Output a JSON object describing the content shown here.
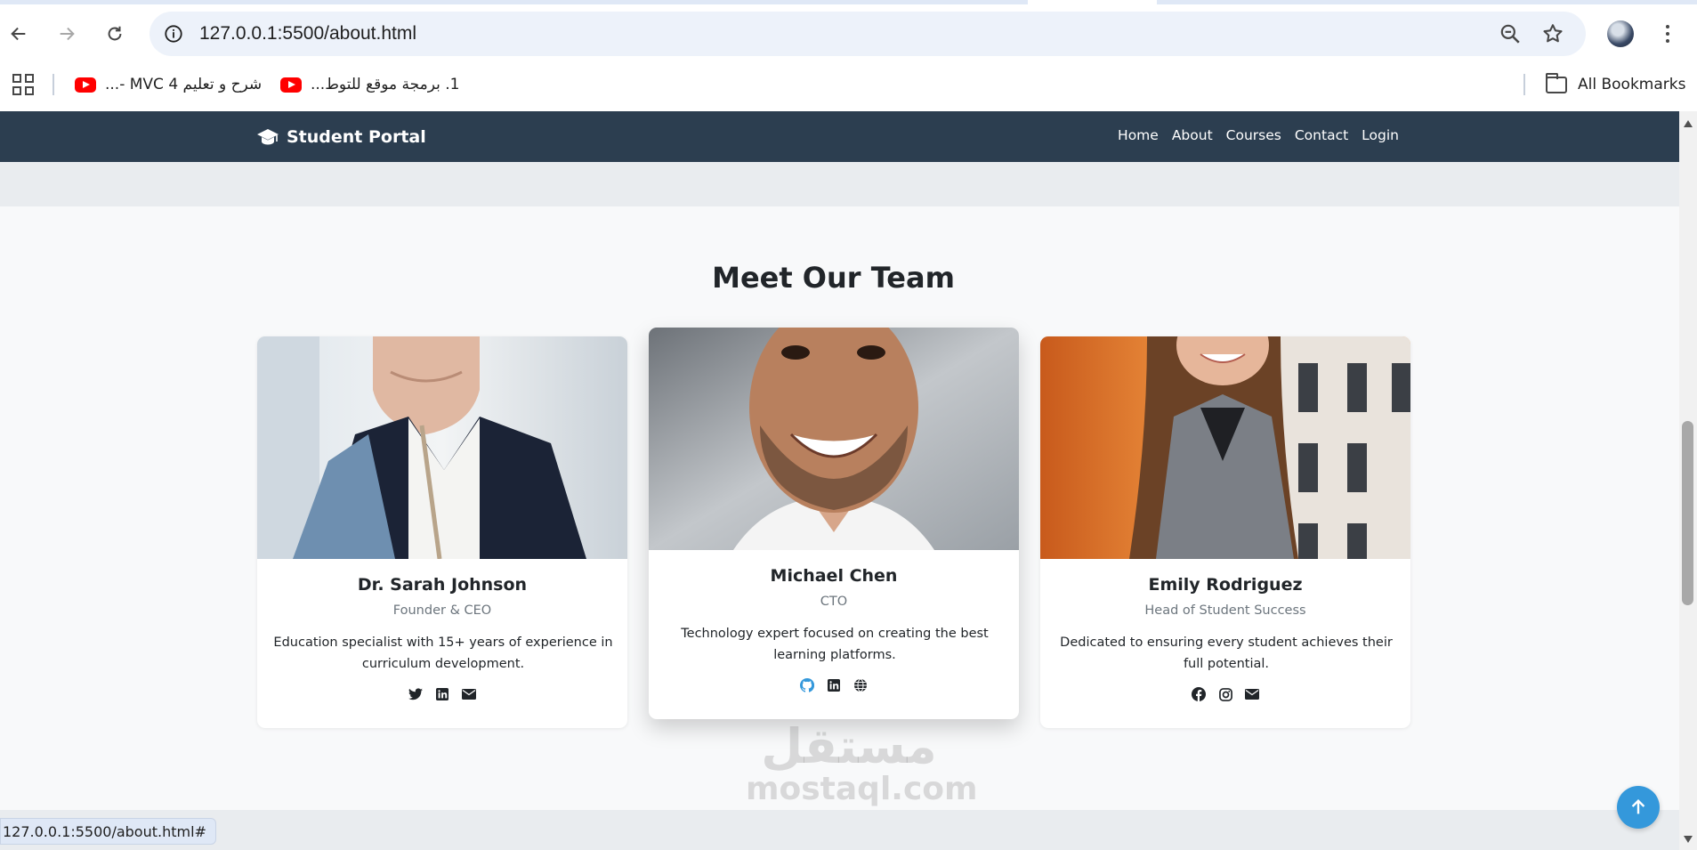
{
  "browser": {
    "url": "127.0.0.1:5500/about.html",
    "bookmarks": [
      {
        "label": "شرح و تعليم 4 MVC -...",
        "icon": "youtube-icon"
      },
      {
        "label": "1. برمجة موقع للتوط...",
        "icon": "youtube-icon"
      }
    ],
    "all_bookmarks_label": "All Bookmarks",
    "status_url": "127.0.0.1:5500/about.html#"
  },
  "site": {
    "brand": "Student Portal",
    "brand_icon": "graduation-cap-icon",
    "nav": [
      "Home",
      "About",
      "Courses",
      "Contact",
      "Login"
    ],
    "nav_bg": "#2c3e50"
  },
  "team": {
    "title": "Meet Our Team",
    "members": [
      {
        "name": "Dr. Sarah Johnson",
        "role": "Founder & CEO",
        "description": "Education specialist with 15+ years of experience in curriculum development.",
        "socials": [
          "twitter-icon",
          "linkedin-icon",
          "envelope-icon"
        ]
      },
      {
        "name": "Michael Chen",
        "role": "CTO",
        "description": "Technology expert focused on creating the best learning platforms.",
        "socials": [
          "github-icon",
          "linkedin-icon",
          "globe-icon"
        ]
      },
      {
        "name": "Emily Rodriguez",
        "role": "Head of Student Success",
        "description": "Dedicated to ensuring every student achieves their full potential.",
        "socials": [
          "facebook-icon",
          "instagram-icon",
          "envelope-icon"
        ]
      }
    ]
  },
  "watermark": {
    "arabic": "مستقل",
    "latin": "mostaql.com"
  },
  "accent_color": "#3498db"
}
